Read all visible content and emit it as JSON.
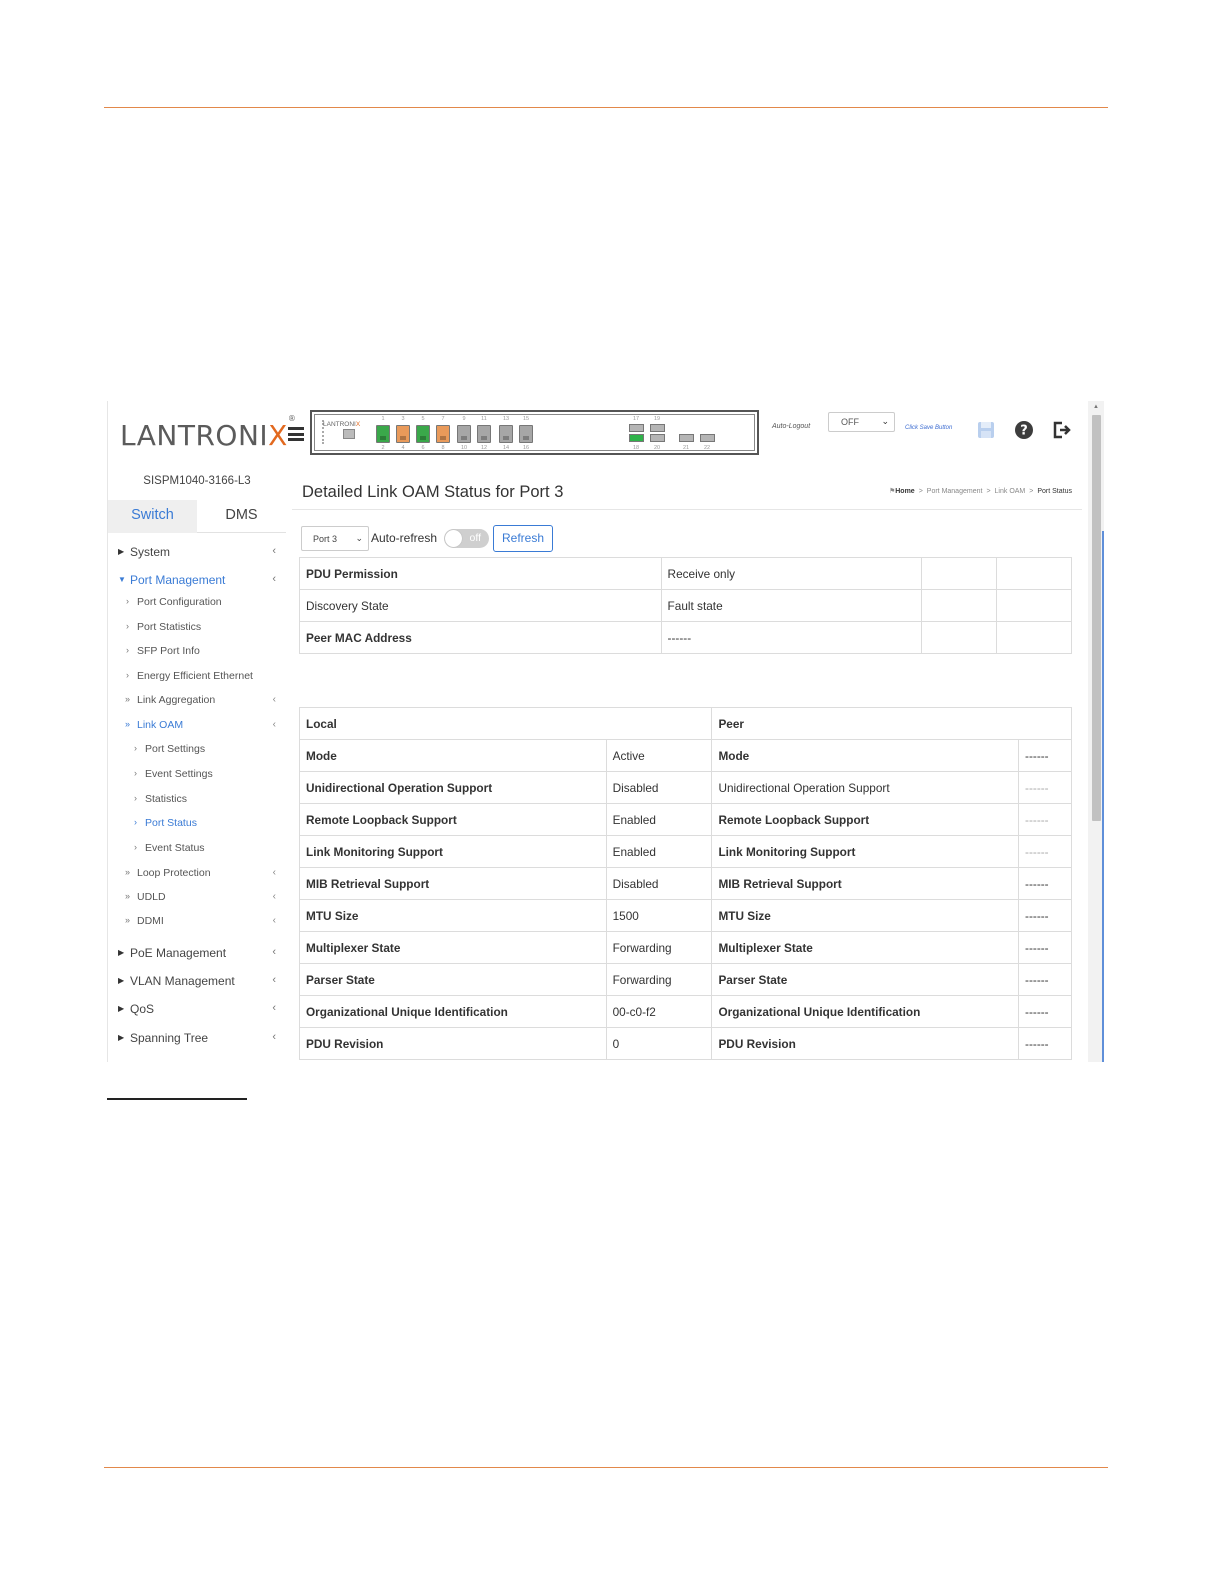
{
  "header": {
    "logo_main": "LANTRONI",
    "logo_x": "X",
    "logo_mark": "®",
    "panel_brand_main": "LANTRONI",
    "panel_brand_x": "X",
    "port_numbers_top": [
      "1",
      "3",
      "5",
      "7",
      "9",
      "11",
      "13",
      "15"
    ],
    "port_numbers_bottom": [
      "2",
      "4",
      "6",
      "8",
      "10",
      "12",
      "14",
      "16"
    ],
    "sfp_numbers_top": [
      "17",
      "19"
    ],
    "sfp_numbers_bottom": [
      "18",
      "20",
      "21",
      "22"
    ],
    "port_colors": {
      "green": "#3aa84a",
      "orange": "#e99a5a",
      "grey": "#a6a6a6"
    },
    "auto_logout_label": "Auto-Logout",
    "auto_logout_value": "OFF",
    "click_save_label": "Click Save Button",
    "icons": [
      "save-icon",
      "help-icon",
      "logout-icon"
    ]
  },
  "sidebar": {
    "device_name": "SISPM1040-3166-L3",
    "tabs": [
      {
        "label": "Switch"
      },
      {
        "label": "DMS"
      }
    ],
    "accent_color": "#3a7bd5",
    "items": [
      {
        "label": "System"
      },
      {
        "label": "Port Management"
      },
      {
        "label": "PoE Management"
      },
      {
        "label": "VLAN Management"
      },
      {
        "label": "QoS"
      },
      {
        "label": "Spanning Tree"
      }
    ],
    "port_mgmt_subitems": [
      {
        "label": "Port Configuration"
      },
      {
        "label": "Port Statistics"
      },
      {
        "label": "SFP Port Info"
      },
      {
        "label": "Energy Efficient Ethernet"
      },
      {
        "label": "Link Aggregation"
      },
      {
        "label": "Link OAM"
      },
      {
        "label": "Loop Protection"
      },
      {
        "label": "UDLD"
      },
      {
        "label": "DDMI"
      }
    ],
    "link_oam_subitems": [
      {
        "label": "Port Settings"
      },
      {
        "label": "Event Settings"
      },
      {
        "label": "Statistics"
      },
      {
        "label": "Port Status"
      },
      {
        "label": "Event Status"
      }
    ]
  },
  "content": {
    "title": "Detailed Link OAM Status for Port 3",
    "breadcrumb": [
      "Home",
      "Port Management",
      "Link OAM",
      "Port Status"
    ],
    "port_select_value": "Port 3",
    "auto_refresh_label": "Auto-refresh",
    "toggle_text": "off",
    "refresh_label": "Refresh",
    "summary_rows": [
      {
        "label": "PDU Permission",
        "value": "Receive only"
      },
      {
        "label": "Discovery State",
        "value": "Fault state"
      },
      {
        "label": "Peer MAC Address",
        "value": "------"
      }
    ],
    "detail_headers": {
      "local": "Local",
      "peer": "Peer"
    },
    "detail_rows": [
      {
        "label": "Mode",
        "local": "Active",
        "peer_label": "Mode",
        "peer": "------"
      },
      {
        "label": "Unidirectional Operation Support",
        "local": "Disabled",
        "peer_label": "Unidirectional Operation Support",
        "peer": "------"
      },
      {
        "label": "Remote Loopback Support",
        "local": "Enabled",
        "peer_label": "Remote Loopback Support",
        "peer": "------"
      },
      {
        "label": "Link Monitoring Support",
        "local": "Enabled",
        "peer_label": "Link Monitoring Support",
        "peer": "------"
      },
      {
        "label": "MIB Retrieval Support",
        "local": "Disabled",
        "peer_label": "MIB Retrieval Support",
        "peer": "------"
      },
      {
        "label": "MTU Size",
        "local": "1500",
        "peer_label": "MTU Size",
        "peer": "------"
      },
      {
        "label": "Multiplexer State",
        "local": "Forwarding",
        "peer_label": "Multiplexer State",
        "peer": "------"
      },
      {
        "label": "Parser State",
        "local": "Forwarding",
        "peer_label": "Parser State",
        "peer": "------"
      },
      {
        "label": "Organizational Unique Identification",
        "local": "00-c0-f2",
        "peer_label": "Organizational Unique Identification",
        "peer": "------"
      },
      {
        "label": "PDU Revision",
        "local": "0",
        "peer_label": "PDU Revision",
        "peer": "------"
      }
    ]
  },
  "page": {
    "rule_color": "#e2884a"
  }
}
